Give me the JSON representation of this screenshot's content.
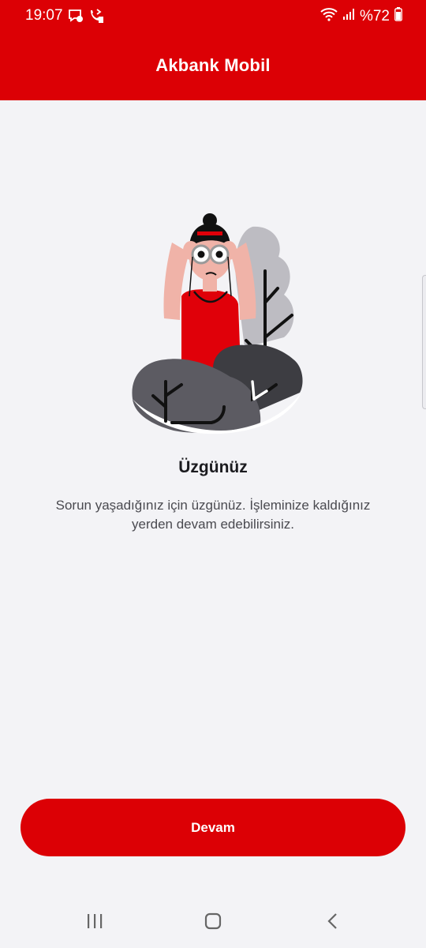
{
  "status_bar": {
    "time": "19:07",
    "battery": "%72",
    "icons": [
      "message-icon",
      "call-forward-icon",
      "wifi-icon",
      "signal-icon",
      "battery-icon"
    ]
  },
  "header": {
    "title": "Akbank Mobil",
    "background_color": "#dc0005"
  },
  "error": {
    "title": "Üzgünüz",
    "message": "Sorun yaşadığınız için üzgünüz. İşleminize kaldığınız yerden devam edebilirsiniz."
  },
  "actions": {
    "continue_label": "Devam"
  },
  "navigation_bar": {
    "buttons": [
      "recent-apps-icon",
      "home-icon",
      "back-icon"
    ]
  }
}
